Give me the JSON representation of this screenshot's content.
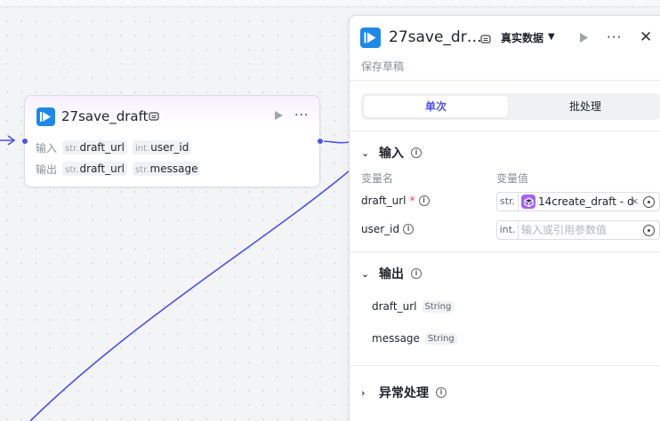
{
  "node": {
    "title": "27save_draft",
    "icons": {
      "logo": "video-logo-icon",
      "badge": "copy-badge-icon",
      "run": "play-icon",
      "more": "more-dots-icon"
    },
    "input_label": "输入",
    "output_label": "输出",
    "inputs": [
      {
        "type": "str.",
        "name": "draft_url"
      },
      {
        "type": "int.",
        "name": "user_id"
      }
    ],
    "outputs": [
      {
        "type": "str.",
        "name": "draft_url"
      },
      {
        "type": "str.",
        "name": "message"
      }
    ]
  },
  "panel": {
    "title": "27save_dr…",
    "data_mode": "真实数据",
    "description": "保存草稿",
    "tabs": [
      {
        "label": "单次",
        "active": true
      },
      {
        "label": "批处理",
        "active": false
      }
    ],
    "input_section": {
      "title": "输入",
      "col_name": "变量名",
      "col_value": "变量值",
      "rows": [
        {
          "name": "draft_url",
          "required_mark": "*",
          "type": "str.",
          "ref_label": "14create_draft - d",
          "ref_icon": "cube-icon"
        },
        {
          "name": "user_id",
          "type": "int.",
          "placeholder": "输入或引用参数值"
        }
      ]
    },
    "output_section": {
      "title": "输出",
      "rows": [
        {
          "name": "draft_url",
          "type": "String"
        },
        {
          "name": "message",
          "type": "String"
        }
      ]
    },
    "error_section": {
      "title": "异常处理"
    }
  },
  "colors": {
    "accent": "#4d53e8",
    "edge": "#4d53e8",
    "ref_chip": "#a564f2"
  }
}
